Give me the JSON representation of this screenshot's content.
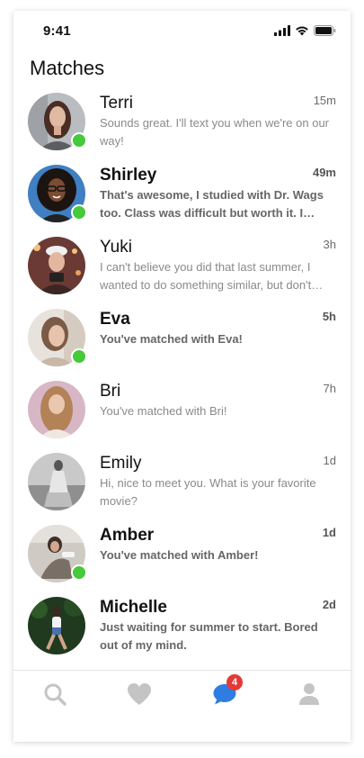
{
  "status_bar": {
    "time": "9:41"
  },
  "header": {
    "title": "Matches"
  },
  "colors": {
    "online": "#46c93a",
    "accent": "#2f7de1",
    "badge": "#e53935",
    "inactive_icon": "#c4c4c4"
  },
  "matches": [
    {
      "name": "Terri",
      "time": "15m",
      "message": "Sounds great. I'll text you when we're on our way!",
      "unread": false,
      "online": true
    },
    {
      "name": "Shirley",
      "time": "49m",
      "message": "That's awesome, I studied with Dr. Wags too. Class was difficult but worth it. I learned so much.",
      "unread": true,
      "online": true
    },
    {
      "name": "Yuki",
      "time": "3h",
      "message": "I can't believe you did that last summer, I wanted to do something similar, but don't know how.",
      "unread": false,
      "online": false
    },
    {
      "name": "Eva",
      "time": "5h",
      "message": "You've matched with Eva!",
      "unread": true,
      "online": true
    },
    {
      "name": "Bri",
      "time": "7h",
      "message": "You've matched with Bri!",
      "unread": false,
      "online": false
    },
    {
      "name": "Emily",
      "time": "1d",
      "message": "Hi, nice to meet you. What is your favorite movie?",
      "unread": false,
      "online": false
    },
    {
      "name": "Amber",
      "time": "1d",
      "message": "You've matched with Amber!",
      "unread": true,
      "online": true
    },
    {
      "name": "Michelle",
      "time": "2d",
      "message": "Just waiting for summer to start. Bored out of my mind.",
      "unread": true,
      "online": false
    }
  ],
  "tab_bar": {
    "tabs": [
      {
        "icon": "search-icon",
        "active": false
      },
      {
        "icon": "heart-icon",
        "active": false
      },
      {
        "icon": "chat-bubble-icon",
        "active": true,
        "badge": "4"
      },
      {
        "icon": "profile-icon",
        "active": false
      }
    ]
  }
}
